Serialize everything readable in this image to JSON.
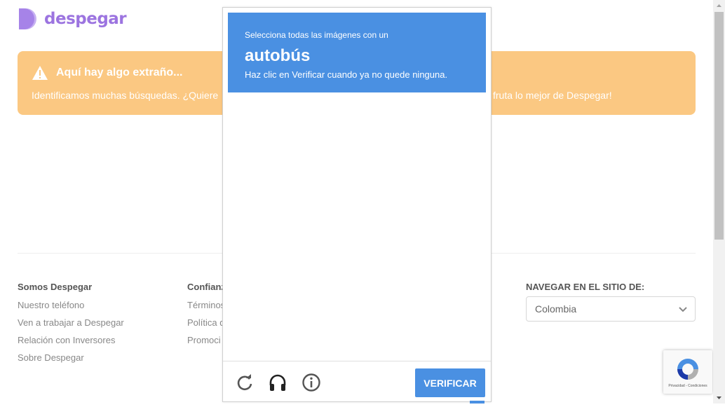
{
  "brand": {
    "name": "despegar",
    "color": "#9c74e0",
    "icon": "despegar-logo-icon"
  },
  "alert": {
    "title": "Aquí hay algo extraño...",
    "text_left": "Identificamos muchas búsquedas. ¿Quiere",
    "text_right": "fruta lo mejor de Despegar!",
    "background": "#fbc882",
    "icon": "warning-icon"
  },
  "footer": {
    "columns": [
      {
        "heading": "Somos Despegar",
        "links": [
          "Nuestro teléfono",
          "Ven a trabajar a Despegar",
          "Relación con Inversores",
          "Sobre Despegar"
        ]
      },
      {
        "heading": "Confianz",
        "links": [
          "Términos",
          "Política d",
          "Promoci"
        ]
      }
    ],
    "nav_site": {
      "heading": "NAVEGAR EN EL SITIO DE:",
      "selected": "Colombia",
      "icon": "chevron-down-icon"
    }
  },
  "captcha": {
    "prompt": "Selecciona todas las imágenes con un",
    "object": "autobús",
    "instruction": "Haz clic en Verificar cuando ya no quede ninguna.",
    "verify_label": "VERIFICAR",
    "accent": "#4a90e2",
    "icons": [
      "reload-icon",
      "audio-headphones-icon",
      "info-icon"
    ]
  },
  "recaptcha_badge": {
    "links": "Privacidad - Condiciones",
    "icon": "recaptcha-logo-icon"
  }
}
